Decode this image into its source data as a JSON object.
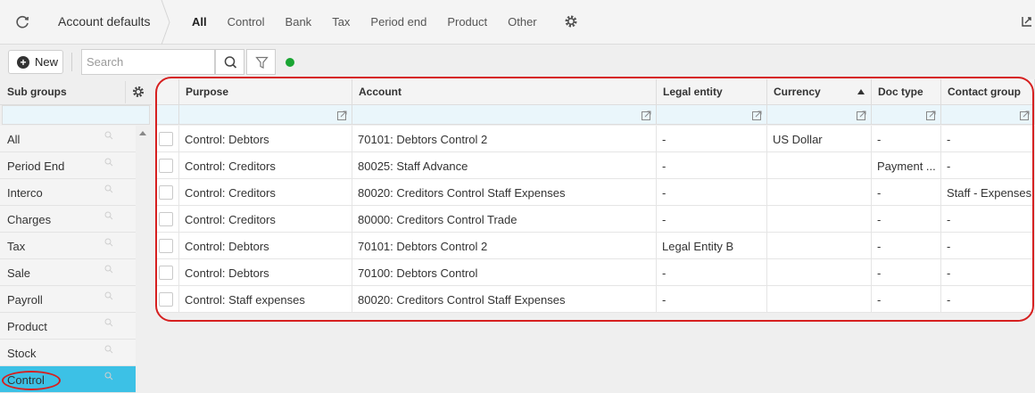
{
  "topbar": {
    "title": "Account defaults",
    "tabs": [
      {
        "label": "All",
        "active": true
      },
      {
        "label": "Control",
        "active": false
      },
      {
        "label": "Bank",
        "active": false
      },
      {
        "label": "Tax",
        "active": false
      },
      {
        "label": "Period end",
        "active": false
      },
      {
        "label": "Product",
        "active": false
      },
      {
        "label": "Other",
        "active": false
      }
    ],
    "icons": {
      "refresh": "refresh-icon",
      "settings": "gear-icon",
      "corner": "export-icon"
    }
  },
  "toolbar": {
    "new_label": "New",
    "search_placeholder": "Search",
    "status_color": "#1aa533"
  },
  "subgroups": {
    "header": "Sub groups",
    "items": [
      {
        "label": "All",
        "selected": false
      },
      {
        "label": "Period End",
        "selected": false
      },
      {
        "label": "Interco",
        "selected": false
      },
      {
        "label": "Charges",
        "selected": false
      },
      {
        "label": "Tax",
        "selected": false
      },
      {
        "label": "Sale",
        "selected": false
      },
      {
        "label": "Payroll",
        "selected": false
      },
      {
        "label": "Product",
        "selected": false
      },
      {
        "label": "Stock",
        "selected": false
      },
      {
        "label": "Control",
        "selected": true
      }
    ],
    "selected_color": "#3cc1e6"
  },
  "grid": {
    "columns": [
      {
        "label": "Purpose"
      },
      {
        "label": "Account"
      },
      {
        "label": "Legal entity"
      },
      {
        "label": "Currency",
        "sorted": "asc"
      },
      {
        "label": "Doc type"
      },
      {
        "label": "Contact group"
      }
    ],
    "rows": [
      [
        "Control: Debtors",
        "70101: Debtors Control 2",
        "-",
        "US Dollar",
        "-",
        "-"
      ],
      [
        "Control: Creditors",
        "80025: Staff Advance",
        "-",
        "",
        "Payment ...",
        "-"
      ],
      [
        "Control: Creditors",
        "80020: Creditors Control Staff Expenses",
        "-",
        "",
        "-",
        "Staff - Expenses"
      ],
      [
        "Control: Creditors",
        "80000: Creditors Control Trade",
        "-",
        "",
        "-",
        "-"
      ],
      [
        "Control: Debtors",
        "70101: Debtors Control 2",
        "Legal Entity B",
        "",
        "-",
        "-"
      ],
      [
        "Control: Debtors",
        "70100: Debtors Control",
        "-",
        "",
        "-",
        "-"
      ],
      [
        "Control: Staff expenses",
        "80020: Creditors Control Staff Expenses",
        "-",
        "",
        "-",
        "-"
      ]
    ]
  },
  "colors": {
    "highlight_ring": "#d62020",
    "filter_row": "#eaf6fb"
  }
}
